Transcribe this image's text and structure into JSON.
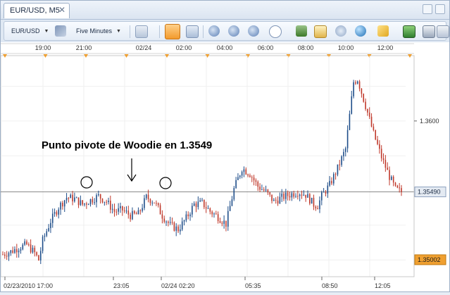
{
  "tab": {
    "label": "EUR/USD, M5",
    "close": "✕"
  },
  "toolbar": {
    "symbol": "EUR/USD",
    "timeframe": "Five Minutes",
    "icons": [
      "candle-type-icon",
      "cursor-icon",
      "chart-style-icon",
      "indicator-icon",
      "objects-icon",
      "zoom-in-icon",
      "zoom-out-icon",
      "zoom-fit-icon",
      "shift-icon",
      "template-icon",
      "refresh-icon",
      "globe-icon",
      "ruler-icon",
      "picture-icon",
      "print-icon"
    ]
  },
  "top_axis": {
    "labels": [
      "19:00",
      "21:00",
      "02/24",
      "02:00",
      "04:00",
      "06:00",
      "08:00",
      "10:00",
      "12:00"
    ]
  },
  "bottom_axis": {
    "labels": [
      "02/23/2010 17:00",
      "23:05",
      "02/24 02:20",
      "05:35",
      "08:50",
      "12:05"
    ]
  },
  "price_axis": {
    "labels": [
      "1.3600",
      "1.35490",
      "1.35002"
    ]
  },
  "annotation": {
    "text": "Punto pivote de Woodie en 1.3549"
  },
  "colors": {
    "up": "#1f4e8a",
    "down": "#c0392b",
    "orange": "#f0a030",
    "pivot_line": "#888888"
  },
  "chart_data": {
    "type": "candlestick",
    "symbol": "EUR/USD",
    "timeframe": "M5",
    "pivot": 1.3549,
    "last_price": 1.3549,
    "low_price_label": 1.35002,
    "ylim": [
      1.3488,
      1.3647
    ],
    "close_path": [
      [
        0,
        1.3504
      ],
      [
        4,
        1.3506
      ],
      [
        8,
        1.3509
      ],
      [
        12,
        1.3511
      ],
      [
        16,
        1.3505
      ],
      [
        18,
        1.35
      ],
      [
        20,
        1.3514
      ],
      [
        24,
        1.3528
      ],
      [
        28,
        1.3538
      ],
      [
        32,
        1.3545
      ],
      [
        36,
        1.3544
      ],
      [
        40,
        1.354
      ],
      [
        44,
        1.3543
      ],
      [
        48,
        1.3546
      ],
      [
        52,
        1.3542
      ],
      [
        56,
        1.3535
      ],
      [
        60,
        1.3536
      ],
      [
        64,
        1.3532
      ],
      [
        68,
        1.3533
      ],
      [
        72,
        1.3545
      ],
      [
        76,
        1.3542
      ],
      [
        80,
        1.3532
      ],
      [
        84,
        1.3525
      ],
      [
        88,
        1.3522
      ],
      [
        92,
        1.353
      ],
      [
        96,
        1.354
      ],
      [
        100,
        1.3541
      ],
      [
        104,
        1.3535
      ],
      [
        108,
        1.3531
      ],
      [
        112,
        1.3526
      ],
      [
        116,
        1.3551
      ],
      [
        120,
        1.3566
      ],
      [
        124,
        1.3562
      ],
      [
        128,
        1.3553
      ],
      [
        132,
        1.3549
      ],
      [
        136,
        1.3542
      ],
      [
        140,
        1.3545
      ],
      [
        144,
        1.3547
      ],
      [
        148,
        1.3549
      ],
      [
        152,
        1.3547
      ],
      [
        156,
        1.354
      ],
      [
        158,
        1.3539
      ],
      [
        160,
        1.3546
      ],
      [
        164,
        1.3554
      ],
      [
        168,
        1.3566
      ],
      [
        172,
        1.358
      ],
      [
        176,
        1.3628
      ],
      [
        178,
        1.363
      ],
      [
        182,
        1.3611
      ],
      [
        186,
        1.3591
      ],
      [
        190,
        1.3574
      ],
      [
        194,
        1.356
      ],
      [
        197,
        1.3551
      ],
      [
        200,
        1.3549
      ]
    ]
  }
}
